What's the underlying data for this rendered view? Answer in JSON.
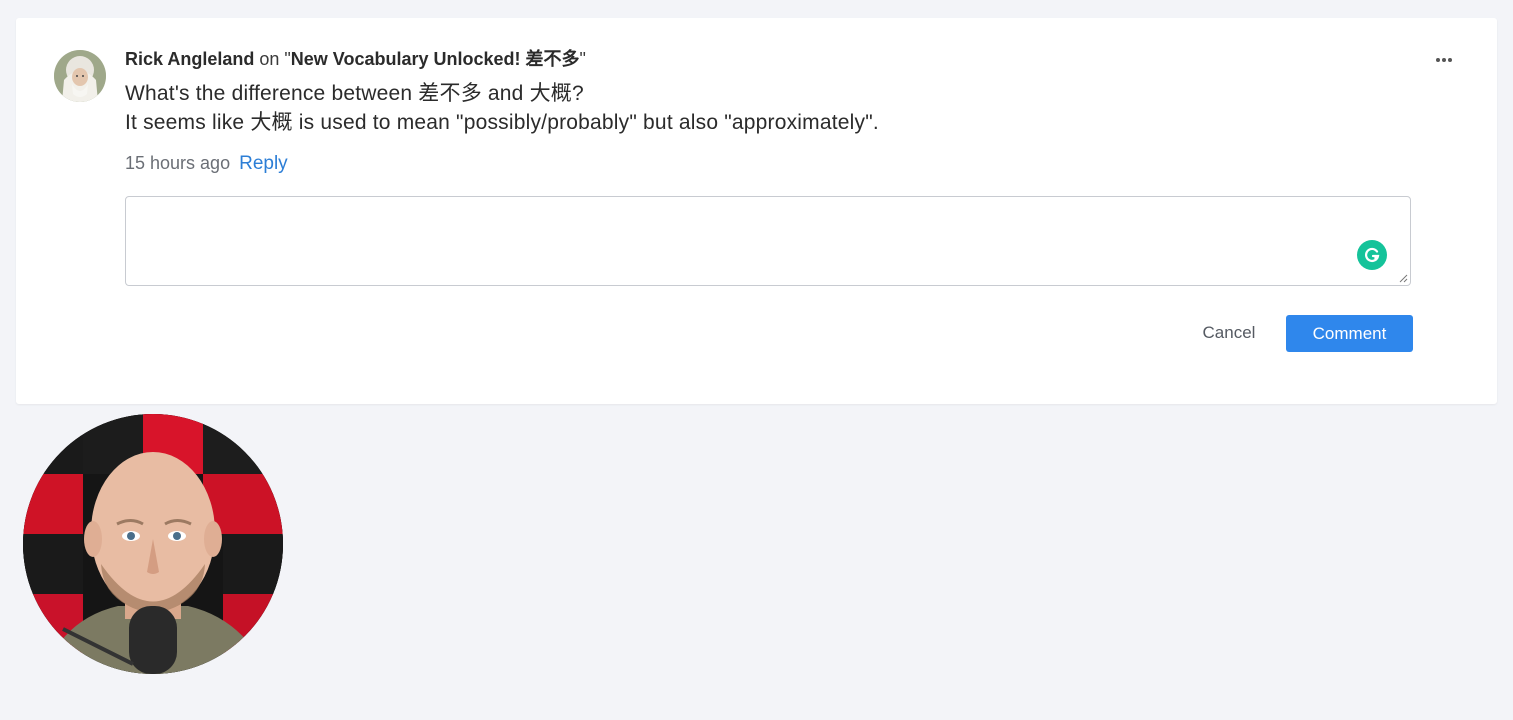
{
  "comment": {
    "author": "Rick Angleland",
    "on_text": " on \"",
    "post_title": "New Vocabulary Unlocked! 差不多",
    "close_quote": "\"",
    "body_lines": [
      "What's the difference between 差不多 and 大概?",
      "It seems like 大概 is used to mean \"possibly/probably\" but also \"approximately\"."
    ],
    "timestamp": "15 hours ago",
    "reply_label": "Reply",
    "more_icon": "ellipsis-horizontal-icon"
  },
  "reply_form": {
    "value": "",
    "placeholder": "",
    "grammarly_icon": "grammarly-icon",
    "cancel_label": "Cancel",
    "submit_label": "Comment"
  },
  "colors": {
    "page_background": "#f3f4f8",
    "card_background": "#ffffff",
    "link": "#2c7ed6",
    "primary_button": "#2f87ec",
    "grammarly": "#15c39a"
  }
}
